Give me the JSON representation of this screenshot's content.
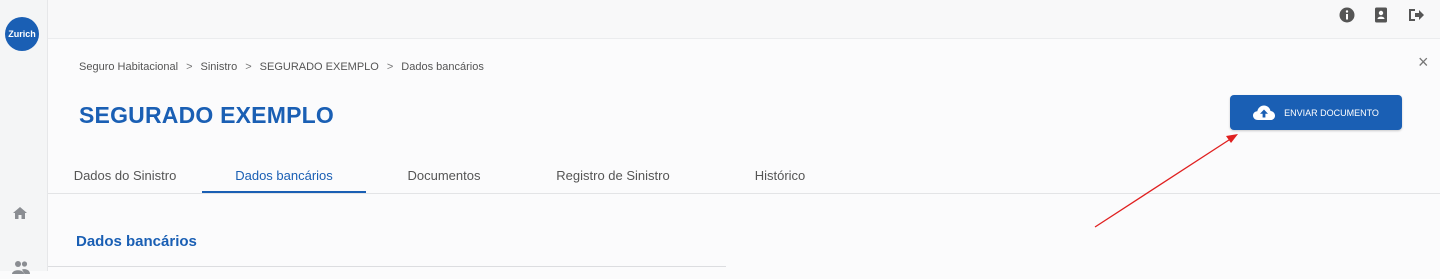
{
  "brand": {
    "logo_text": "Zurich",
    "accent": "#1a5fb4"
  },
  "sidebar": {
    "items": [
      {
        "icon": "home-icon"
      },
      {
        "icon": "users-icon"
      }
    ]
  },
  "topbar": {
    "icons": [
      "info-icon",
      "contact-book-icon",
      "logout-icon"
    ]
  },
  "close_label": "×",
  "breadcrumb": {
    "items": [
      "Seguro Habitacional",
      "Sinistro",
      "SEGURADO EXEMPLO",
      "Dados bancários"
    ],
    "separator": ">"
  },
  "page": {
    "title": "SEGURADO EXEMPLO"
  },
  "actions": {
    "send_document": "ENVIAR DOCUMENTO"
  },
  "tabs": [
    {
      "label": "Dados do Sinistro"
    },
    {
      "label": "Dados bancários",
      "active": true
    },
    {
      "label": "Documentos"
    },
    {
      "label": "Registro de Sinistro"
    },
    {
      "label": "Histórico"
    }
  ],
  "section": {
    "title": "Dados bancários"
  },
  "annotation": {
    "arrow_color": "#e02020"
  }
}
